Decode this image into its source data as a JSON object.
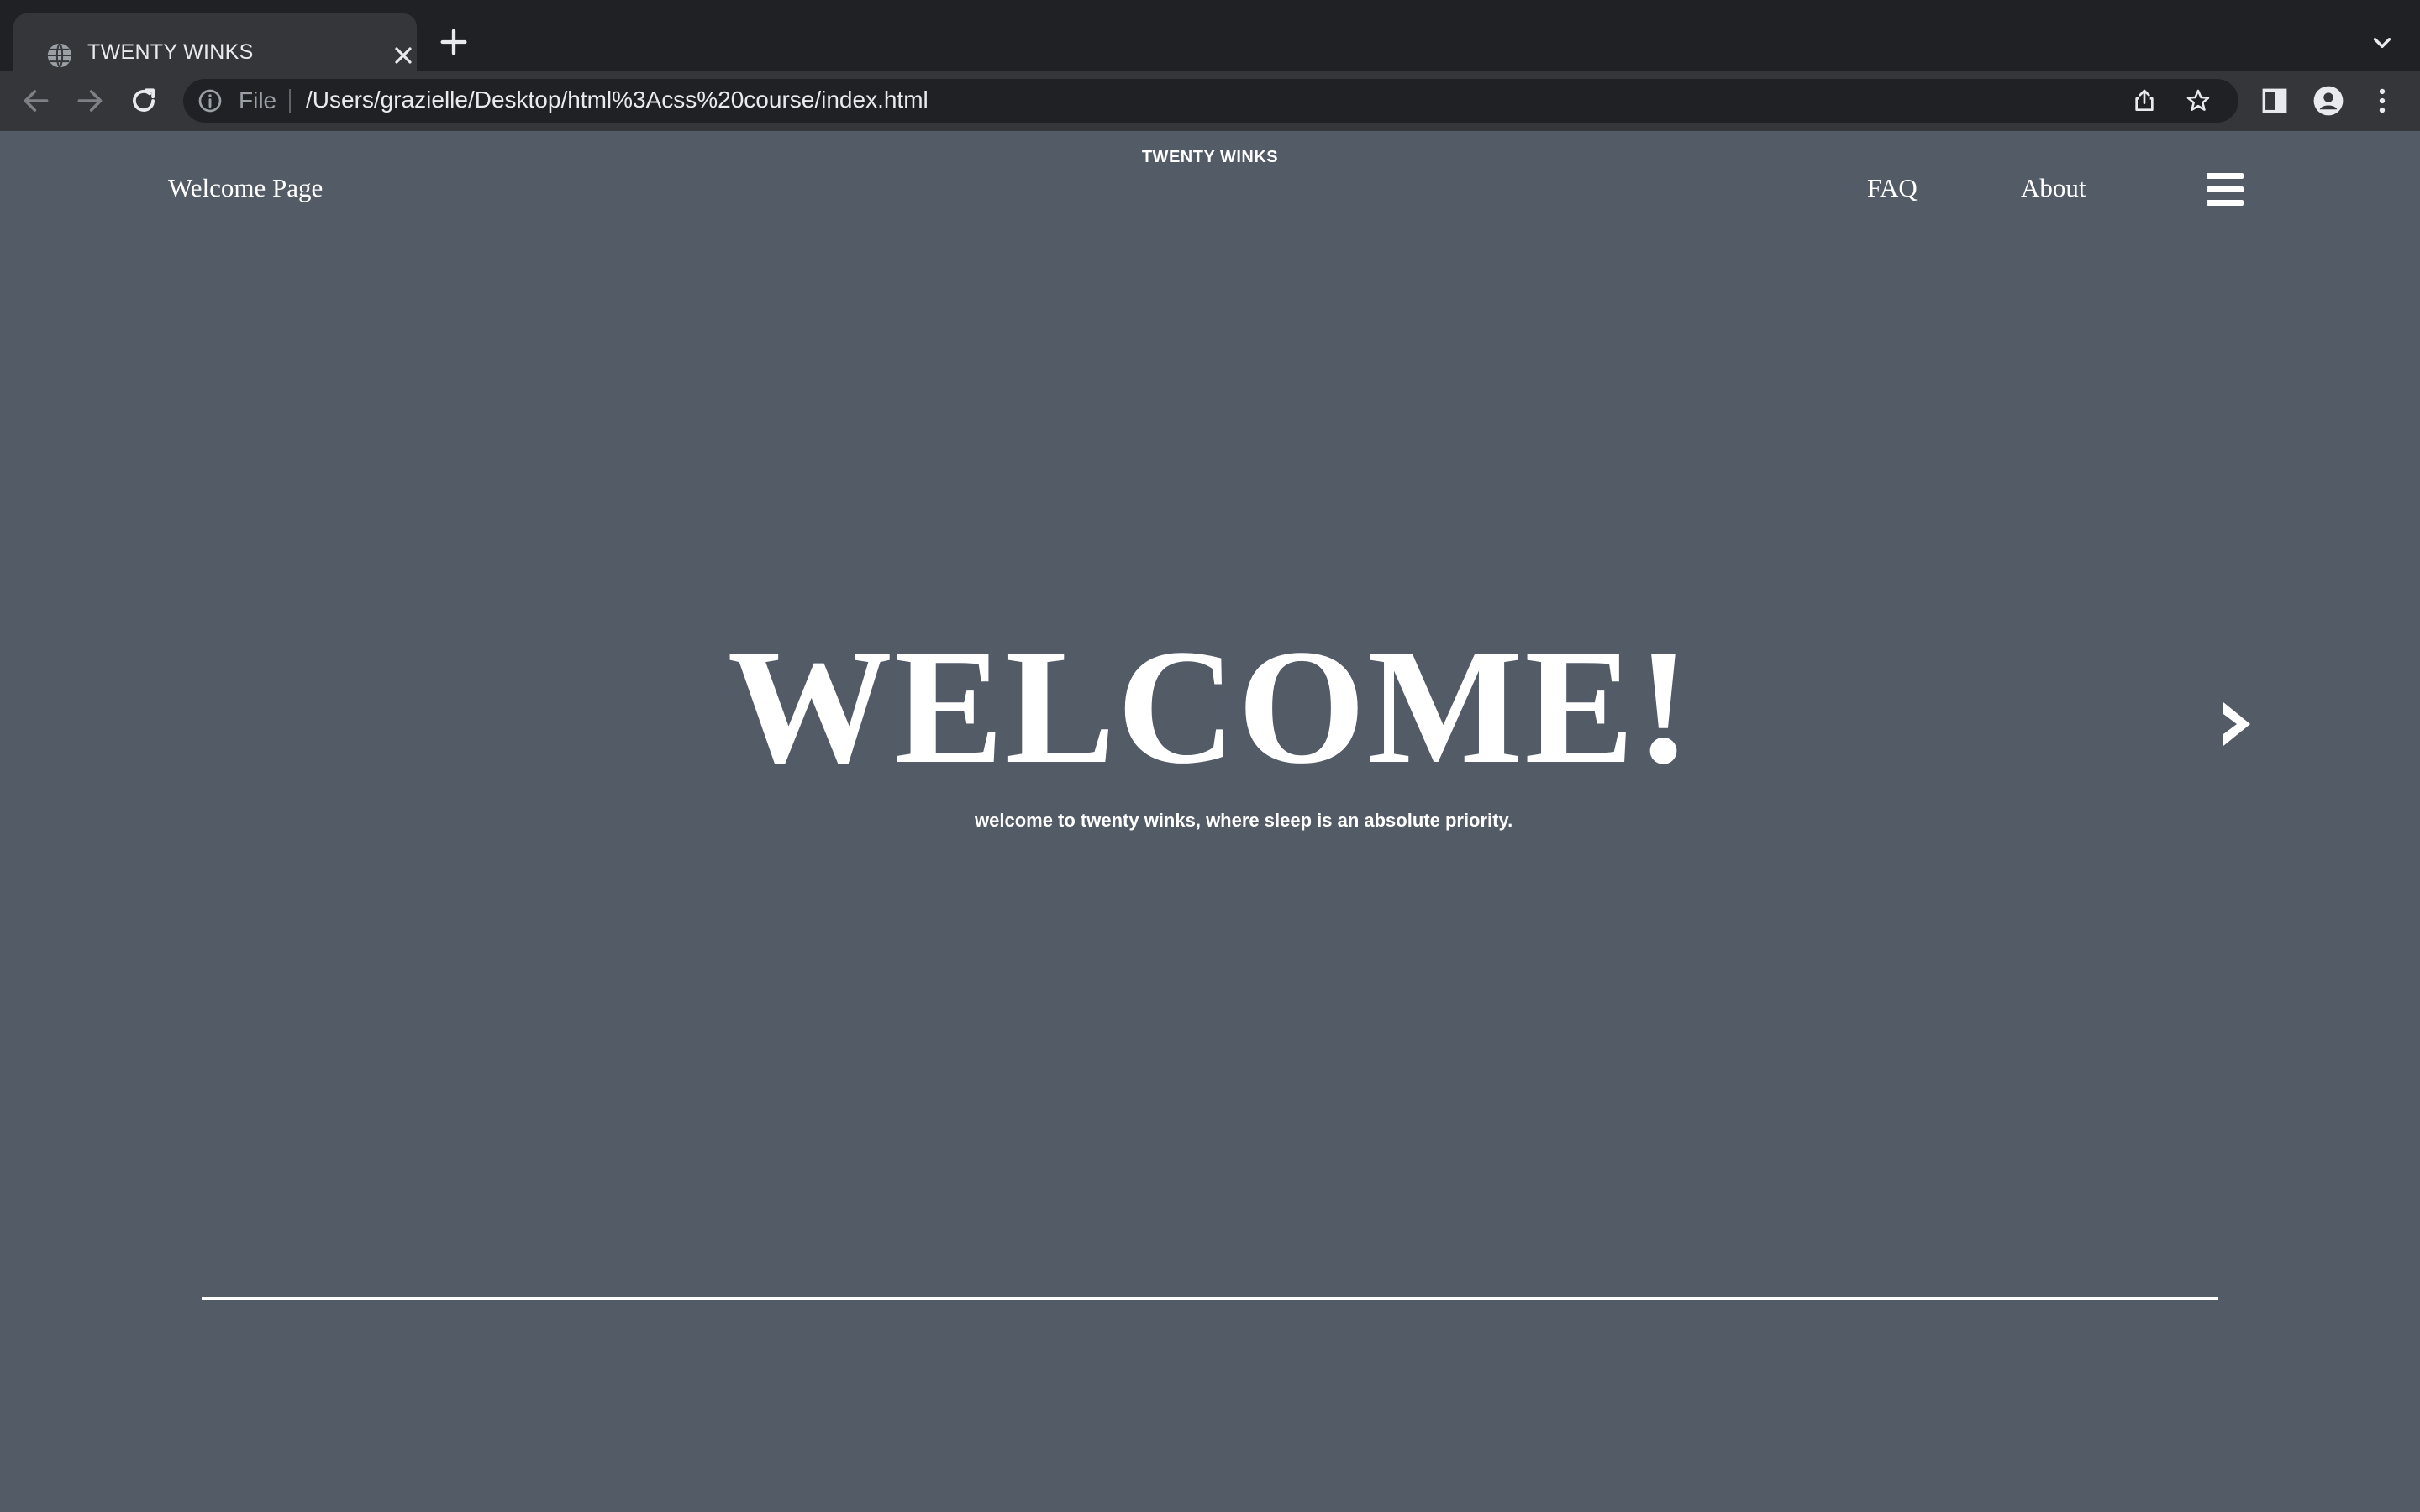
{
  "browser": {
    "tab": {
      "title": "TWENTY WINKS",
      "favicon": "globe-icon"
    },
    "address_bar": {
      "scheme_label": "File",
      "url": "/Users/grazielle/Desktop/html%3Acss%20course/index.html"
    },
    "colors": {
      "tabstrip_bg": "#202124",
      "toolbar_bg": "#35363a",
      "omnibox_bg": "#202124",
      "text": "#e8eaed",
      "muted_text": "#9aa0a6"
    }
  },
  "page": {
    "brand": "TWENTY WINKS",
    "nav": {
      "home_label": "Welcome Page",
      "faq_label": "FAQ",
      "about_label": "About",
      "menu_icon": "hamburger-menu-icon"
    },
    "hero": {
      "title": "WELCOME!",
      "subtitle": "welcome to twenty winks, where sleep is an absolute priority.",
      "next_icon": "chevron-right-icon"
    },
    "colors": {
      "background": "#535b67",
      "text": "#ffffff"
    }
  }
}
